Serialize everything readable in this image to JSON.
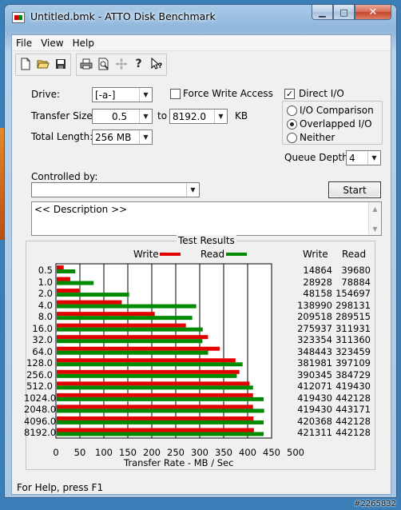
{
  "window": {
    "title": "Untitled.bmk - ATTO Disk Benchmark",
    "close_glyph": "✕",
    "min_glyph": "▁",
    "max_glyph": "□"
  },
  "menu": [
    "File",
    "View",
    "Help"
  ],
  "toolbar_icons": [
    "new-icon",
    "open-icon",
    "save-icon",
    "print-icon",
    "print-preview-icon",
    "move-icon",
    "help-icon",
    "context-help-icon"
  ],
  "form": {
    "drive_label": "Drive:",
    "drive_value": "[-a-]",
    "force_write_label": "Force Write Access",
    "force_write_checked": false,
    "direct_io_label": "Direct I/O",
    "direct_io_checked": true,
    "transfer_size_label": "Transfer Size:",
    "transfer_from": "0.5",
    "to_label": "to",
    "transfer_to": "8192.0",
    "kb_label": "KB",
    "total_length_label": "Total Length:",
    "total_length_value": "256 MB",
    "io_modes": [
      {
        "label": "I/O Comparison",
        "selected": false
      },
      {
        "label": "Overlapped I/O",
        "selected": true
      },
      {
        "label": "Neither",
        "selected": false
      }
    ],
    "queue_depth_label": "Queue Depth:",
    "queue_depth_value": "4",
    "controlled_by_label": "Controlled by:",
    "controlled_by_value": "",
    "start_label": "Start",
    "description": "<< Description >>"
  },
  "results": {
    "title": "Test Results",
    "legend_write": "Write",
    "legend_read": "Read",
    "write_header": "Write",
    "read_header": "Read",
    "colors": {
      "write": "#e30000",
      "read": "#008a00"
    }
  },
  "chart_data": {
    "type": "bar",
    "orientation": "horizontal",
    "categories": [
      "0.5",
      "1.0",
      "2.0",
      "4.0",
      "8.0",
      "16.0",
      "32.0",
      "64.0",
      "128.0",
      "256.0",
      "512.0",
      "1024.0",
      "2048.0",
      "4096.0",
      "8192.0"
    ],
    "series": [
      {
        "name": "Write",
        "values": [
          14864,
          28928,
          48158,
          138990,
          209518,
          275937,
          323354,
          348443,
          381981,
          390345,
          412071,
          419430,
          419430,
          420368,
          421311
        ]
      },
      {
        "name": "Read",
        "values": [
          39680,
          78884,
          154697,
          298131,
          289515,
          311931,
          311360,
          323459,
          397109,
          384729,
          419430,
          442128,
          443171,
          442128,
          442128
        ]
      }
    ],
    "write_display": [
      "14864",
      "28928",
      "48158",
      "138990",
      "209518",
      "275937",
      "323354",
      "348443",
      "381981",
      "390345",
      "412071",
      "419430",
      "419430",
      "420368",
      "421311"
    ],
    "read_display": [
      "39680",
      "78884",
      "154697",
      "298131",
      "289515",
      "311931",
      "311360",
      "323459",
      "397109",
      "384729",
      "419430",
      "442128",
      "443171",
      "442128",
      "442128"
    ],
    "xticks": [
      "0",
      "50",
      "100",
      "150",
      "200",
      "250",
      "300",
      "350",
      "400",
      "450",
      "500"
    ],
    "xlim": [
      0,
      500
    ],
    "xlabel": "Transfer Rate - MB / Sec",
    "grid": true
  },
  "statusbar": "For Help, press F1",
  "watermark": "#2265832"
}
